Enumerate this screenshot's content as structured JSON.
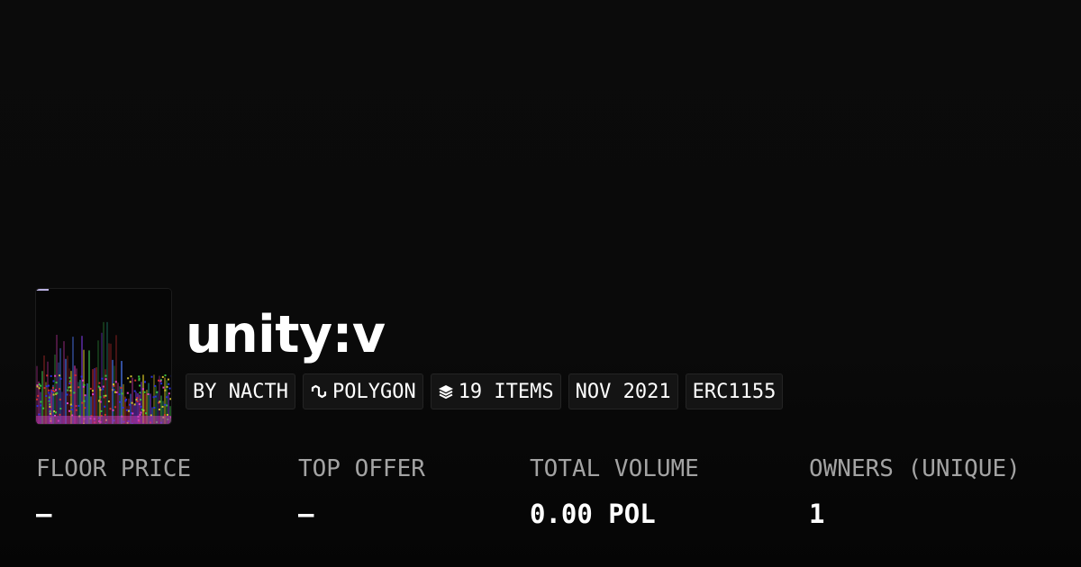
{
  "collection": {
    "title": "unity:v",
    "thumbnail_icon": "spectrogram-artwork"
  },
  "tags": {
    "creator": "BY NACTH",
    "chain": "POLYGON",
    "chain_icon": "polygon-link-icon",
    "items": "19 ITEMS",
    "items_icon": "layers-icon",
    "date": "NOV 2021",
    "standard": "ERC1155"
  },
  "stats": [
    {
      "label": "FLOOR PRICE",
      "value": "–"
    },
    {
      "label": "TOP OFFER",
      "value": "–"
    },
    {
      "label": "TOTAL VOLUME",
      "value": "0.00 POL"
    },
    {
      "label": "OWNERS (UNIQUE)",
      "value": "1"
    }
  ],
  "colors": {
    "background": "#0a0a0a",
    "tag_background": "#141414",
    "label": "#a3a3a3",
    "text": "#ffffff"
  }
}
